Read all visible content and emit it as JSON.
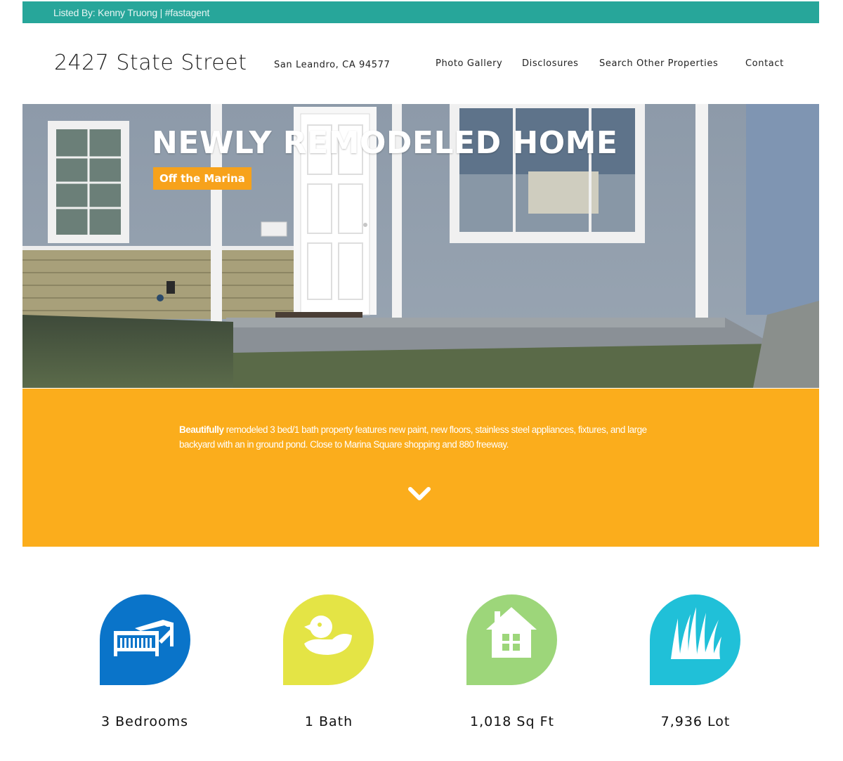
{
  "topbar": {
    "text": "Listed By: Kenny Truong | #fastagent"
  },
  "header": {
    "title": "2427 State Street",
    "subtitle": "San Leandro, CA 94577",
    "nav": [
      "Photo Gallery",
      "Disclosures",
      "Search Other Properties",
      "Contact"
    ]
  },
  "hero": {
    "title": "NEWLY REMODELED HOME",
    "badge": "Off the Marina"
  },
  "description": {
    "lead": "Beautifully",
    "body": " remodeled 3 bed/1 bath property features new paint, new floors, stainless steel appliances, fixtures, and large backyard with an in ground pond. Close to Marina Square shopping and 880 freeway.",
    "scroll_icon": "chevron-down-icon"
  },
  "features": [
    {
      "label": "3 Bedrooms",
      "icon": "bed-icon",
      "color": "#0a74c9"
    },
    {
      "label": "1 Bath",
      "icon": "duck-icon",
      "color": "#e4e445"
    },
    {
      "label": "1,018 Sq Ft",
      "icon": "house-icon",
      "color": "#9dd67a"
    },
    {
      "label": "7,936 Lot",
      "icon": "grass-icon",
      "color": "#20c0d8"
    }
  ],
  "colors": {
    "topbar": "#27a69a",
    "accent_orange": "#fbad1c",
    "badge_orange": "#f7a21b"
  }
}
